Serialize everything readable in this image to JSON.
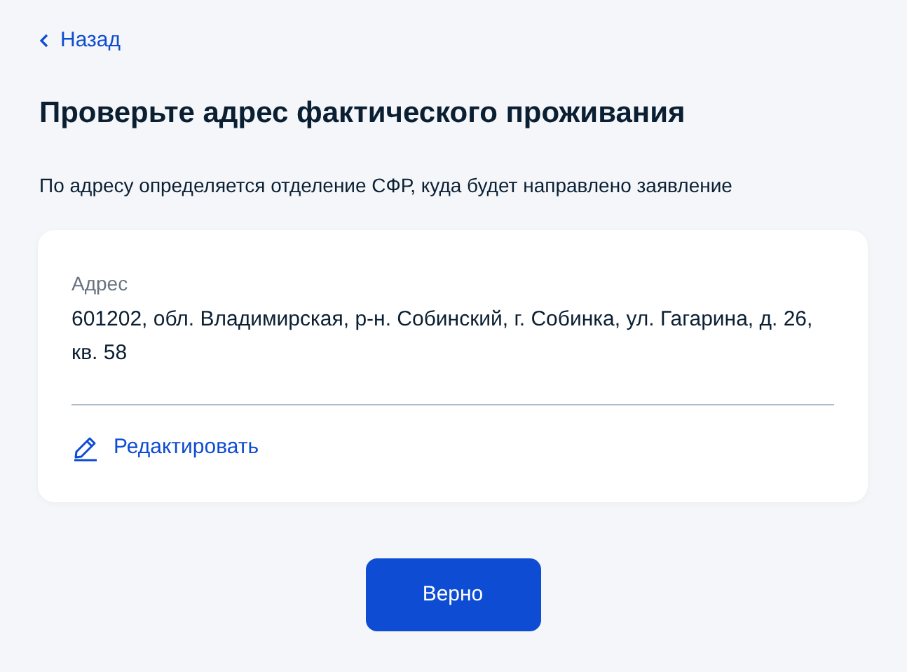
{
  "back_link": {
    "label": "Назад"
  },
  "title": "Проверьте адрес фактического проживания",
  "subtitle": "По адресу определяется отделение СФР, куда будет направлено заявление",
  "card": {
    "label": "Адрес",
    "value": "601202, обл. Владимирская, р-н. Собинский, г. Собинка, ул. Гагарина, д. 26, кв. 58",
    "edit_link": "Редактировать"
  },
  "button": "Верно"
}
